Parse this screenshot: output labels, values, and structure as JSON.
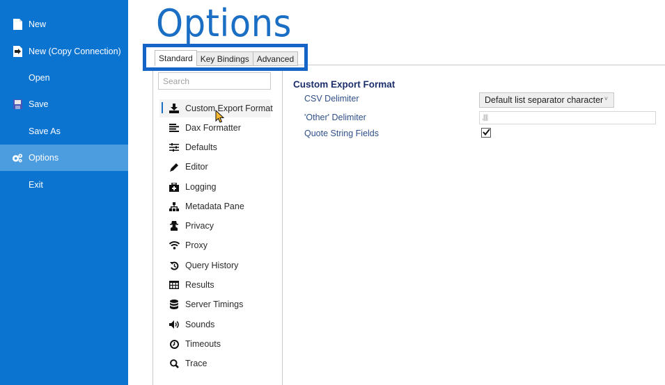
{
  "sidebar": {
    "items": [
      {
        "label": "New",
        "icon": "new-document-icon"
      },
      {
        "label": "New (Copy Connection)",
        "icon": "copy-connection-icon"
      },
      {
        "label": "Open",
        "icon": ""
      },
      {
        "label": "Save",
        "icon": "save-icon"
      },
      {
        "label": "Save As",
        "icon": ""
      },
      {
        "label": "Options",
        "icon": "gears-icon",
        "active": true
      },
      {
        "label": "Exit",
        "icon": ""
      }
    ]
  },
  "header": {
    "title": "Options"
  },
  "tabs": [
    {
      "label": "Standard",
      "active": true
    },
    {
      "label": "Key Bindings"
    },
    {
      "label": "Advanced"
    }
  ],
  "search": {
    "placeholder": "Search"
  },
  "nav": {
    "items": [
      {
        "label": "Custom Export Format",
        "icon": "download-icon",
        "active": true
      },
      {
        "label": "Dax Formatter",
        "icon": "align-lines-icon"
      },
      {
        "label": "Defaults",
        "icon": "sliders-icon"
      },
      {
        "label": "Editor",
        "icon": "pencil-icon"
      },
      {
        "label": "Logging",
        "icon": "medkit-icon"
      },
      {
        "label": "Metadata Pane",
        "icon": "sitemap-icon"
      },
      {
        "label": "Privacy",
        "icon": "user-secret-icon"
      },
      {
        "label": "Proxy",
        "icon": "wifi-icon"
      },
      {
        "label": "Query History",
        "icon": "history-icon"
      },
      {
        "label": "Results",
        "icon": "table-icon"
      },
      {
        "label": "Server Timings",
        "icon": "database-icon"
      },
      {
        "label": "Sounds",
        "icon": "volume-icon"
      },
      {
        "label": "Timeouts",
        "icon": "clock-icon"
      },
      {
        "label": "Trace",
        "icon": "search-icon"
      }
    ]
  },
  "content": {
    "section_title": "Custom Export Format",
    "csv_delimiter": {
      "label": "CSV Delimiter",
      "value": "Default list separator character"
    },
    "other_delimiter": {
      "label": "'Other' Delimiter",
      "value": ",||||"
    },
    "quote_string_fields": {
      "label": "Quote String Fields",
      "checked": true
    }
  },
  "colors": {
    "sidebar_bg": "#0B74D1",
    "sidebar_active": "#4C9CE0",
    "title": "#1A6FC4",
    "highlight_box": "#1565C8",
    "section_title": "#1B2E6B",
    "field_label": "#2F4F8A"
  }
}
